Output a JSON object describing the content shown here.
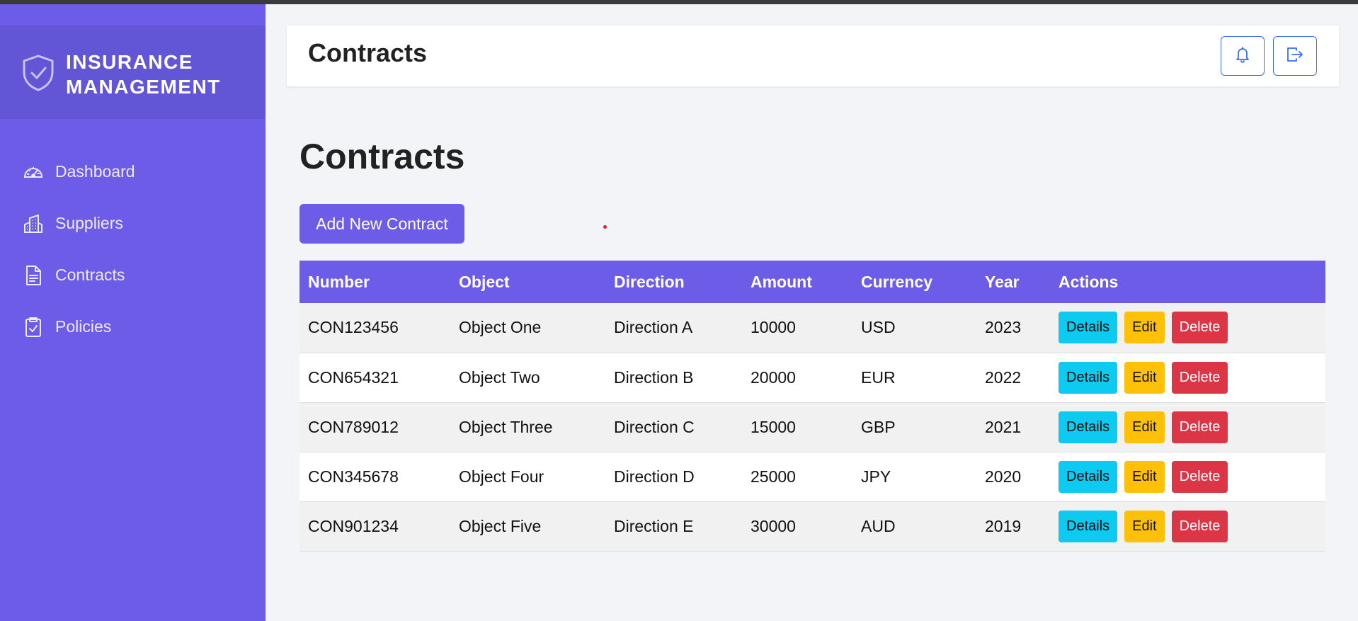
{
  "colors": {
    "sidebar": "#6c5ce7",
    "brand_block": "#6255d6",
    "accent": "#6c5ce7",
    "details_button": "#0dcaf0",
    "edit_button": "#ffc107",
    "delete_button": "#dc3545",
    "header_button_border": "#3b6df0"
  },
  "sidebar": {
    "brand": {
      "icon": "shield-check-icon",
      "title": "INSURANCE\nMANAGEMENT"
    },
    "items": [
      {
        "label": "Dashboard",
        "icon": "gauge-icon"
      },
      {
        "label": "Suppliers",
        "icon": "building-icon"
      },
      {
        "label": "Contracts",
        "icon": "document-icon"
      },
      {
        "label": "Policies",
        "icon": "clipboard-check-icon"
      }
    ]
  },
  "header": {
    "title": "Contracts",
    "buttons": [
      {
        "icon": "bell-icon"
      },
      {
        "icon": "logout-icon"
      }
    ]
  },
  "main": {
    "title": "Contracts",
    "add_button_label": "Add New Contract",
    "table": {
      "columns": [
        "Number",
        "Object",
        "Direction",
        "Amount",
        "Currency",
        "Year",
        "Actions"
      ],
      "rows": [
        {
          "number": "CON123456",
          "object": "Object One",
          "direction": "Direction A",
          "amount": "10000",
          "currency": "USD",
          "year": "2023"
        },
        {
          "number": "CON654321",
          "object": "Object Two",
          "direction": "Direction B",
          "amount": "20000",
          "currency": "EUR",
          "year": "2022"
        },
        {
          "number": "CON789012",
          "object": "Object Three",
          "direction": "Direction C",
          "amount": "15000",
          "currency": "GBP",
          "year": "2021"
        },
        {
          "number": "CON345678",
          "object": "Object Four",
          "direction": "Direction D",
          "amount": "25000",
          "currency": "JPY",
          "year": "2020"
        },
        {
          "number": "CON901234",
          "object": "Object Five",
          "direction": "Direction E",
          "amount": "30000",
          "currency": "AUD",
          "year": "2019"
        }
      ],
      "actions": {
        "details": "Details",
        "edit": "Edit",
        "delete": "Delete"
      }
    }
  }
}
